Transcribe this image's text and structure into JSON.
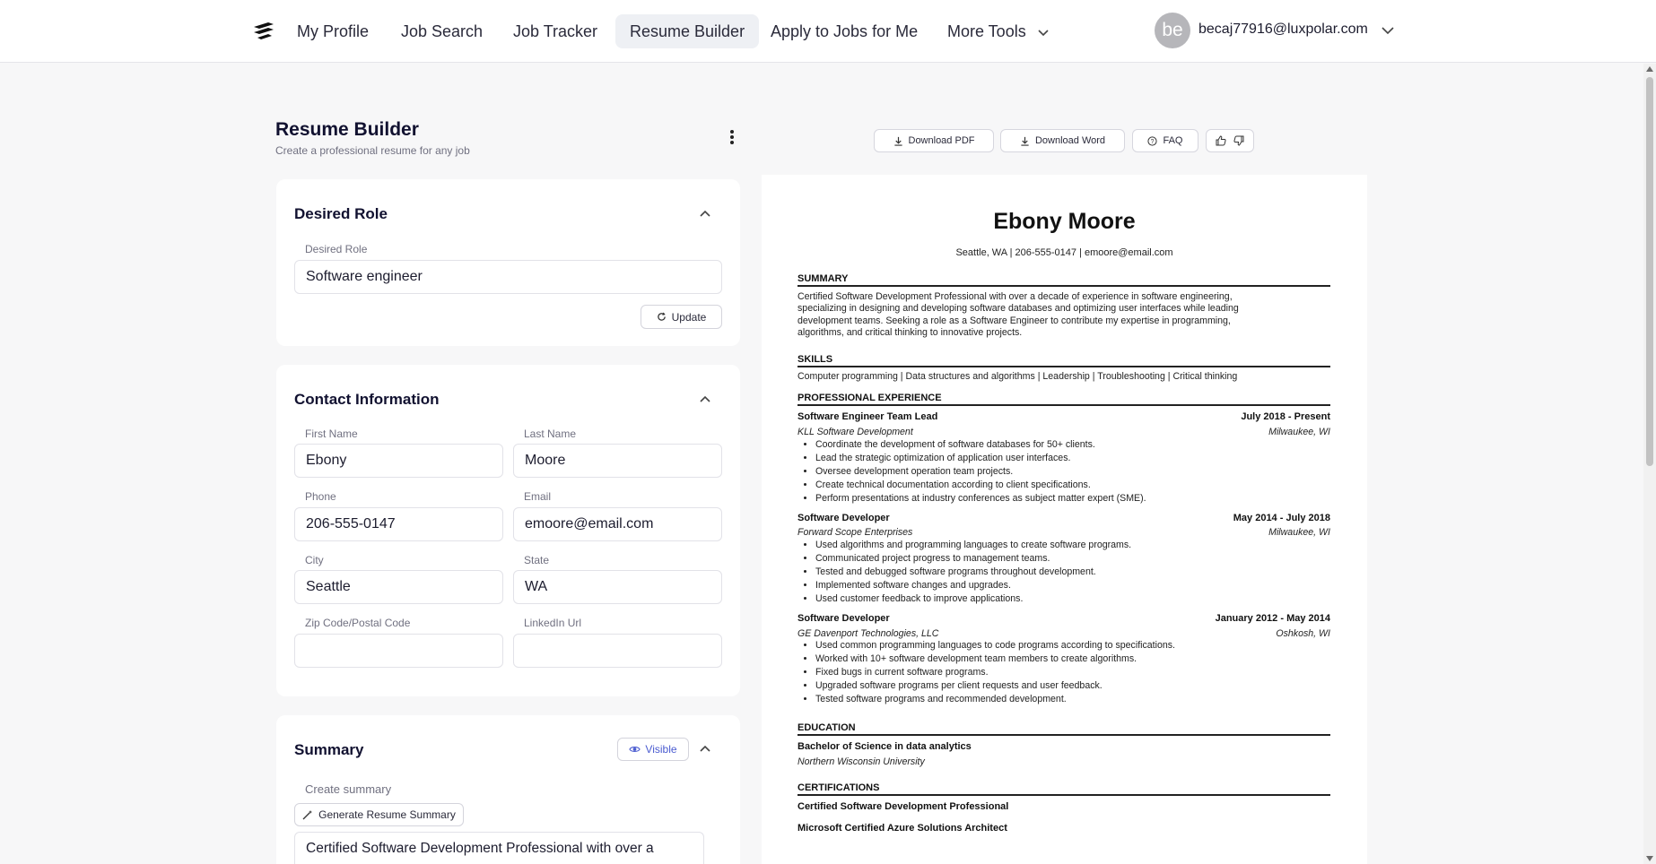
{
  "nav": {
    "logo_icon": "logo-icon",
    "items": [
      {
        "label": "My Profile",
        "active": false
      },
      {
        "label": "Job Search",
        "active": false
      },
      {
        "label": "Job Tracker",
        "active": false
      },
      {
        "label": "Resume Builder",
        "active": true
      },
      {
        "label": "Apply to Jobs for Me",
        "active": false
      },
      {
        "label": "More Tools",
        "active": false
      }
    ],
    "user": {
      "avatar_initials": "be",
      "email": "becaj77916@luxpolar.com"
    }
  },
  "page": {
    "title": "Resume Builder",
    "subtitle": "Create a professional resume for any job"
  },
  "desired_role": {
    "title": "Desired Role",
    "field_label": "Desired Role",
    "value": "Software engineer",
    "update_label": "Update"
  },
  "contact": {
    "title": "Contact Information",
    "first_name": {
      "label": "First Name",
      "value": "Ebony"
    },
    "last_name": {
      "label": "Last Name",
      "value": "Moore"
    },
    "phone": {
      "label": "Phone",
      "value": "206-555-0147"
    },
    "email": {
      "label": "Email",
      "value": "emoore@email.com"
    },
    "city": {
      "label": "City",
      "value": "Seattle"
    },
    "state": {
      "label": "State",
      "value": "WA"
    },
    "zip": {
      "label": "Zip Code/Postal Code",
      "value": ""
    },
    "linkedin": {
      "label": "LinkedIn Url",
      "value": ""
    }
  },
  "summary_card": {
    "title": "Summary",
    "visible_label": "Visible",
    "create_label": "Create summary",
    "generate_label": "Generate Resume Summary",
    "text": "Certified Software Development Professional with over a"
  },
  "toolbar": {
    "download_pdf": "Download PDF",
    "download_word": "Download Word",
    "faq": "FAQ"
  },
  "resume": {
    "name": "Ebony Moore",
    "contact_line": "Seattle, WA  | 206-555-0147  | emoore@email.com",
    "summary_heading": "SUMMARY",
    "summary_lines": [
      "Certified Software Development Professional with over a decade of experience in software engineering,",
      "specializing in designing and developing software databases and optimizing user interfaces while leading",
      "development teams. Seeking a role as a Software Engineer to contribute my expertise in programming,",
      "algorithms, and critical thinking to innovative projects."
    ],
    "skills_heading": "SKILLS",
    "skills": "Computer programming | Data structures and algorithms | Leadership | Troubleshooting | Critical thinking",
    "experience_heading": "PROFESSIONAL EXPERIENCE",
    "jobs": [
      {
        "title": "Software Engineer Team Lead",
        "dates": "July 2018 - Present",
        "company": "KLL Software Development",
        "location": "Milwaukee, WI",
        "bullets": [
          "Coordinate the development of software databases for 50+ clients.",
          "Lead the strategic optimization of application user interfaces.",
          "Oversee development operation team projects.",
          "Create technical documentation according to client specifications.",
          "Perform presentations at industry conferences as subject matter expert (SME)."
        ]
      },
      {
        "title": "Software Developer",
        "dates": "May 2014 - July 2018",
        "company": "Forward Scope Enterprises",
        "location": "Milwaukee, WI",
        "bullets": [
          "Used algorithms and programming languages to create software programs.",
          "Communicated project progress to management teams.",
          "Tested and debugged software programs throughout development.",
          "Implemented software changes and upgrades.",
          "Used customer feedback to improve applications."
        ]
      },
      {
        "title": "Software Developer",
        "dates": "January 2012 - May 2014",
        "company": "GE Davenport Technologies, LLC",
        "location": "Oshkosh, WI",
        "bullets": [
          "Used common programming languages to code programs according to specifications.",
          "Worked with 10+ software development team members to create algorithms.",
          "Fixed bugs in current software programs.",
          "Upgraded software programs per client requests and user feedback.",
          "Tested software programs and recommended development."
        ]
      }
    ],
    "education_heading": "EDUCATION",
    "degree": "Bachelor of Science in data analytics",
    "school": "Northern Wisconsin University",
    "certifications_heading": "CERTIFICATIONS",
    "certifications": [
      "Certified Software Development Professional",
      "Microsoft Certified Azure Solutions Architect"
    ]
  },
  "colors": {
    "accent": "#4a5bd0",
    "nav_active_bg": "#eef0f4",
    "page_bg": "#f7f7f8"
  }
}
